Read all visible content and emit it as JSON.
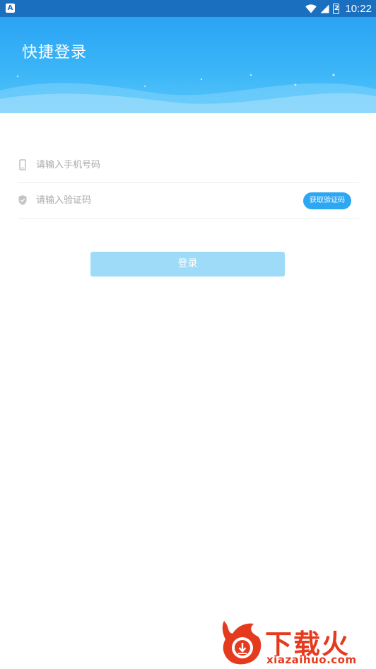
{
  "status_bar": {
    "notification_icon": "A",
    "time": "10:22",
    "battery_level": "2"
  },
  "header": {
    "title": "快捷登录"
  },
  "phone_field": {
    "placeholder": "请输入手机号码",
    "icon": "phone-icon"
  },
  "code_field": {
    "placeholder": "请输入验证码",
    "icon": "shield-icon",
    "get_code_label": "获取验证码"
  },
  "login_button": {
    "label": "登录"
  },
  "watermark": {
    "brand": "下载火",
    "url": "xiazaihuo.com"
  },
  "colors": {
    "status_bar": "#1b6fbf",
    "header_blue": "#2aa4f4",
    "accent": "#2ea7f2",
    "login_disabled": "#9ddbf9",
    "watermark_red": "#e63a1e"
  }
}
